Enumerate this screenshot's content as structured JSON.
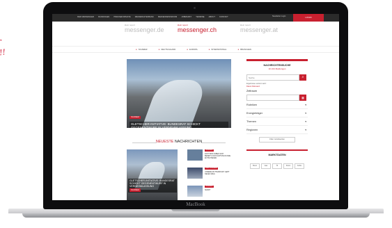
{
  "handwriting": {
    "line1": "r",
    "line2": "!!"
  },
  "laptop": {
    "brand": "MacBook"
  },
  "topbar": {
    "nav": [
      "DER MESSENGER",
      "RANKINGEN",
      "PRESSEFORMATE",
      "MEDIENDATENBANK",
      "MEDIENNEWSROOM",
      "JOBMARKT",
      "TERMINE",
      "ABOUT",
      "KONTAKT"
    ],
    "right_text": "Newsletter Login",
    "login_label": "LOGIN"
  },
  "logos": [
    {
      "small": "klein report",
      "big": "messenger.de",
      "active": false
    },
    {
      "small": "klein report",
      "big": "messenger.ch",
      "active": true
    },
    {
      "small": "klein report",
      "big": "messenger.at",
      "active": false
    }
  ],
  "secnav": [
    "SCHWEIZ",
    "DEUTSCHLAND",
    "EUROPA",
    "INTERNATIONAL",
    "BRANCHEN"
  ],
  "hero": {
    "tag": "SCHWEIZ",
    "title": "GLETSCHER-INITIATIVE: BUNDESRAT SCHICKT GEGENENTWURF IN VERNEHMLASSUNG"
  },
  "newest": {
    "word1": "NEUESTE",
    "word2": "NACHRICHTEN"
  },
  "card_main": {
    "title": "GLETSCHER-INITIATIVE: BUNDESRAT SCHICKT GEGENENTWURF IN VERNEHMLASSUNG",
    "tag": "SCHWEIZ"
  },
  "side_items": [
    {
      "tag": "SCHWEIZ",
      "text": "FAST 5000 HABEN SICH BEREITS FÜR NÄCHSTE RUNDE ENTSCHIEDEN"
    },
    {
      "tag": "DEUTSCHLAND",
      "text": "UNSERE MUTTERSTADT GEHT NEUEN WEG"
    },
    {
      "tag": "SCHWEIZ",
      "text": "SMART"
    }
  ],
  "sidebar": {
    "title": "NACHRICHTENSUCHE",
    "count": "10 244 Meldungen",
    "search_placeholder": "Suche",
    "search_hint": "Ergebnisse sortiert nach:",
    "sort_options": "Datum  Relevanz",
    "date_label": "Zeitraum",
    "filters": [
      "Rubriken",
      "Energieträger",
      "Themen",
      "Regionen"
    ],
    "reset_label": "Filter zurücksetzen",
    "market_title": "MARKTDATEN",
    "market_tabs": [
      "Brent",
      "Gas",
      "Öl",
      "Strom",
      "Kohle"
    ]
  }
}
